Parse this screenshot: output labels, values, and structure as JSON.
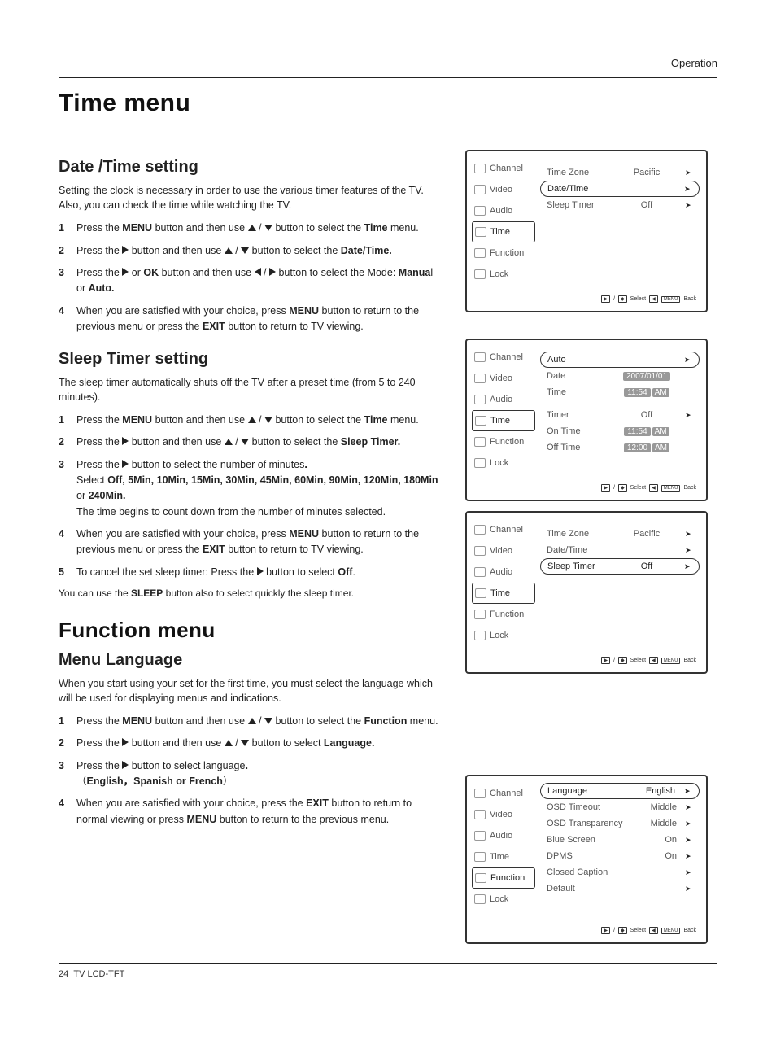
{
  "header": {
    "section": "Operation"
  },
  "title1": "Time menu",
  "datetime": {
    "heading": "Date /Time setting",
    "intro": "Setting the clock is necessary in order to use the various timer features of the TV. Also, you can check the time while watching the TV.",
    "s1_a": "Press the ",
    "s1_b": "MENU",
    "s1_c": " button and then use ",
    "s1_d": " button to select the ",
    "s1_e": "Time",
    "s1_f": " menu.",
    "s2_a": "Press the ",
    "s2_b": " button and then use ",
    "s2_c": " button to select the ",
    "s2_d": "Date/Time.",
    "s3_a": "Press the ",
    "s3_b": " or ",
    "s3_c": "OK",
    "s3_d": " button and then use ",
    "s3_e": " button to select the Mode: ",
    "s3_f": "Manua",
    "s3_g": "l or ",
    "s3_h": "Auto.",
    "s4_a": "When you are satisfied with your choice, press ",
    "s4_b": "MENU",
    "s4_c": " button to return to the previous menu or press the ",
    "s4_d": "EXIT",
    "s4_e": " button to return to TV viewing."
  },
  "sleep": {
    "heading": "Sleep Timer setting",
    "intro": "The sleep timer automatically shuts off the TV after a preset time (from 5 to 240 minutes).",
    "s1_a": "Press the ",
    "s1_b": "MENU",
    "s1_c": " button and then use ",
    "s1_d": " button to select the ",
    "s1_e": "Time",
    "s1_f": " menu.",
    "s2_a": "Press the ",
    "s2_b": " button and then use ",
    "s2_c": " button to select the ",
    "s2_d": "Sleep Timer.",
    "s3_a": "Press the ",
    "s3_b": " button  to select the number of minutes",
    "s3_c": ".",
    "s3_d": "Select ",
    "s3_e": "Off, 5Min, 10Min, 15Min, 30Min, 45Min, 60Min, 90Min, 120Min, 180Min",
    "s3_f": " or ",
    "s3_g": "240Min.",
    "s3_h": "The time begins to count down from the number of minutes selected.",
    "s4_a": "When you are satisfied with your choice, press ",
    "s4_b": "MENU",
    "s4_c": " button to return to the previous menu or press the ",
    "s4_d": "EXIT",
    "s4_e": " button to return to TV viewing.",
    "s5_a": "To cancel the set sleep timer: Press the ",
    "s5_b": " button to select ",
    "s5_c": "Off",
    "s5_d": ".",
    "note_a": "You can use the ",
    "note_b": "SLEEP",
    "note_c": " button also to select quickly the sleep timer."
  },
  "title2": "Function menu",
  "menulang": {
    "heading": "Menu Language",
    "intro": "When you start using your set for the first time, you must select the language which will be used for displaying menus and indications.",
    "s1_a": "Press the ",
    "s1_b": "MENU",
    "s1_c": " button and then use ",
    "s1_d": " button to select the ",
    "s1_e": "Function",
    "s1_f": " menu.",
    "s2_a": "Press the ",
    "s2_b": " button and then use ",
    "s2_c": " button to select ",
    "s2_d": "Language.",
    "s3_a": "Press the ",
    "s3_b": " button  to select  language",
    "s3_c": ".",
    "s3_d": "（",
    "s3_e": "English，Spanish or French",
    "s3_f": "）",
    "s4_a": "When you are satisfied with your choice, press the ",
    "s4_b": "EXIT",
    "s4_c": " button to return to normal viewing or press ",
    "s4_d": "MENU",
    "s4_e": " button to return to the previous menu."
  },
  "osd_sidebar": {
    "channel": "Channel",
    "video": "Video",
    "audio": "Audio",
    "time": "Time",
    "function": "Function",
    "lock": "Lock"
  },
  "osd1": {
    "r1_label": "Time Zone",
    "r1_val": "Pacific",
    "r2_label": "Date/Time",
    "r3_label": "Sleep Timer",
    "r3_val": "Off"
  },
  "osd2": {
    "r1_label": "Auto",
    "r2_label": "Date",
    "r2_val": "2007/01/01",
    "r3_label": "Time",
    "r3_val_a": "11:54",
    "r3_val_b": "AM",
    "r4_label": "Timer",
    "r4_val": "Off",
    "r5_label": "On Time",
    "r5_val_a": "11:54",
    "r5_val_b": "AM",
    "r6_label": "Off Time",
    "r6_val_a": "12:00",
    "r6_val_b": "AM"
  },
  "osd3": {
    "r1_label": "Time Zone",
    "r1_val": "Pacific",
    "r2_label": "Date/Time",
    "r3_label": "Sleep Timer",
    "r3_val": "Off"
  },
  "osd4": {
    "r1_label": "Language",
    "r1_val": "English",
    "r2_label": "OSD Timeout",
    "r2_val": "Middle",
    "r3_label": "OSD Transparency",
    "r3_val": "Middle",
    "r4_label": "Blue Screen",
    "r4_val": "On",
    "r5_label": "DPMS",
    "r5_val": "On",
    "r6_label": "Closed Caption",
    "r7_label": "Default"
  },
  "osd_footer": {
    "select": "Select",
    "back": "Back",
    "menu": "MENU"
  },
  "footer": {
    "page": "24",
    "model": "TV LCD-TFT"
  }
}
